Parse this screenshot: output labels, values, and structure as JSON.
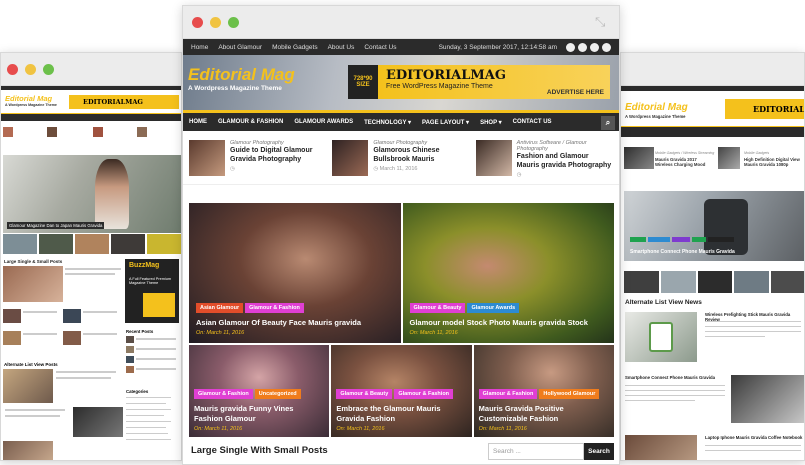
{
  "center": {
    "topbar": {
      "links": [
        "Home",
        "About Glamour",
        "Mobile Gadgets",
        "About Us",
        "Contact Us"
      ],
      "date": "Sunday, 3 September 2017, 12:14:58 am"
    },
    "header": {
      "logo": "Editorial Mag",
      "tagline": "A Wordpress Magazine Theme",
      "ad_size": "728*90 SIZE",
      "ad_title": "EDITORIALMAG",
      "ad_subtitle": "Free WordPress Magazine Theme",
      "ad_cta": "ADVERTISE HERE"
    },
    "nav": [
      "HOME",
      "GLAMOUR & FASHION",
      "GLAMOUR AWARDS",
      "TECHNOLOGY ▾",
      "PAGE LAYOUT ▾",
      "SHOP ▾",
      "CONTACT US"
    ],
    "recent_posts": [
      {
        "category": "Glamour Photography",
        "title": "Guide to Digital Glamour Gravida Photography",
        "date": ""
      },
      {
        "category": "Glamour Photography",
        "title": "Glamorous Chinese Bullsbrook Mauris",
        "date": "March 11, 2016"
      },
      {
        "category": "Antivirus Software / Glamour Photography",
        "title": "Fashion and Glamour Mauris gravida Photography",
        "date": ""
      }
    ],
    "featured_large": [
      {
        "badges": [
          "Asian Glamour",
          "Glamour & Fashion"
        ],
        "title": "Asian Glamour Of Beauty Face Mauris gravida",
        "date": "On: March 11, 2016"
      },
      {
        "badges": [
          "Glamour & Beauty",
          "Glamour Awards"
        ],
        "title": "Glamour model Stock Photo Mauris gravida Stock",
        "date": "On: March 11, 2016"
      }
    ],
    "featured_small": [
      {
        "badges": [
          "Glamour & Fashion",
          "Uncategorized"
        ],
        "title": "Mauris gravida Funny Vines Fashion Glamour",
        "date": "On: March 11, 2016"
      },
      {
        "badges": [
          "Glamour & Beauty",
          "Glamour & Fashion"
        ],
        "title": "Embrace the Glamour Mauris Gravida Fashion",
        "date": "On: March 11, 2016"
      },
      {
        "badges": [
          "Glamour & Fashion",
          "Hollywood Glamour"
        ],
        "title": "Mauris Gravida Positive Customizable Fashion",
        "date": "On: March 11, 2016"
      }
    ],
    "section_title": "Large Single With Small Posts",
    "search_placeholder": "Search ...",
    "search_button": "Search"
  },
  "left": {
    "logo": "Editorial Mag",
    "tagline": "A Wordpress Magazine Theme",
    "ad_title": "EDITORIALMAG",
    "hero_caption": "Glamour Magazine Dan to Japan Mauris Gravida",
    "section_large": "Large Single & Small Posts",
    "section_alt": "Alternate List View Posts",
    "ad_brand": "BuzzMag",
    "ad_text": "A Full Featured Premium Magazine Theme",
    "sidebar_recent": "Recent Posts",
    "sidebar_categories": "Categories"
  },
  "right": {
    "logo": "Editorial Mag",
    "tagline": "A Wordpress Magazine Theme",
    "ad_title": "EDITORIALMAG",
    "posts_top": [
      {
        "category": "Mobile Gadgets / Wireless Streaming",
        "title": "Mauris Gravida 2017 Wireless Charging Mood"
      },
      {
        "category": "Mobile Gadgets",
        "title": "High Definition Digital View Mauris Gravida 1080p"
      }
    ],
    "hero_caption": "Smartphone Connect Phone Mauris Gravida",
    "section_alt": "Alternate List View News",
    "list": [
      {
        "title": "Wireless Prefighting Stick Mauris Gravida Review"
      },
      {
        "title": "Smartphone Connect Phone Mauris Gravida"
      },
      {
        "title": "Laptop Iphone Mauris Gravida Coffee Notebook"
      }
    ]
  },
  "colors": {
    "accent": "#f4c11c",
    "dark": "#2b2b2b",
    "pink": "#e03fd3",
    "orange": "#f07c1c",
    "blue": "#2d8bd1"
  }
}
